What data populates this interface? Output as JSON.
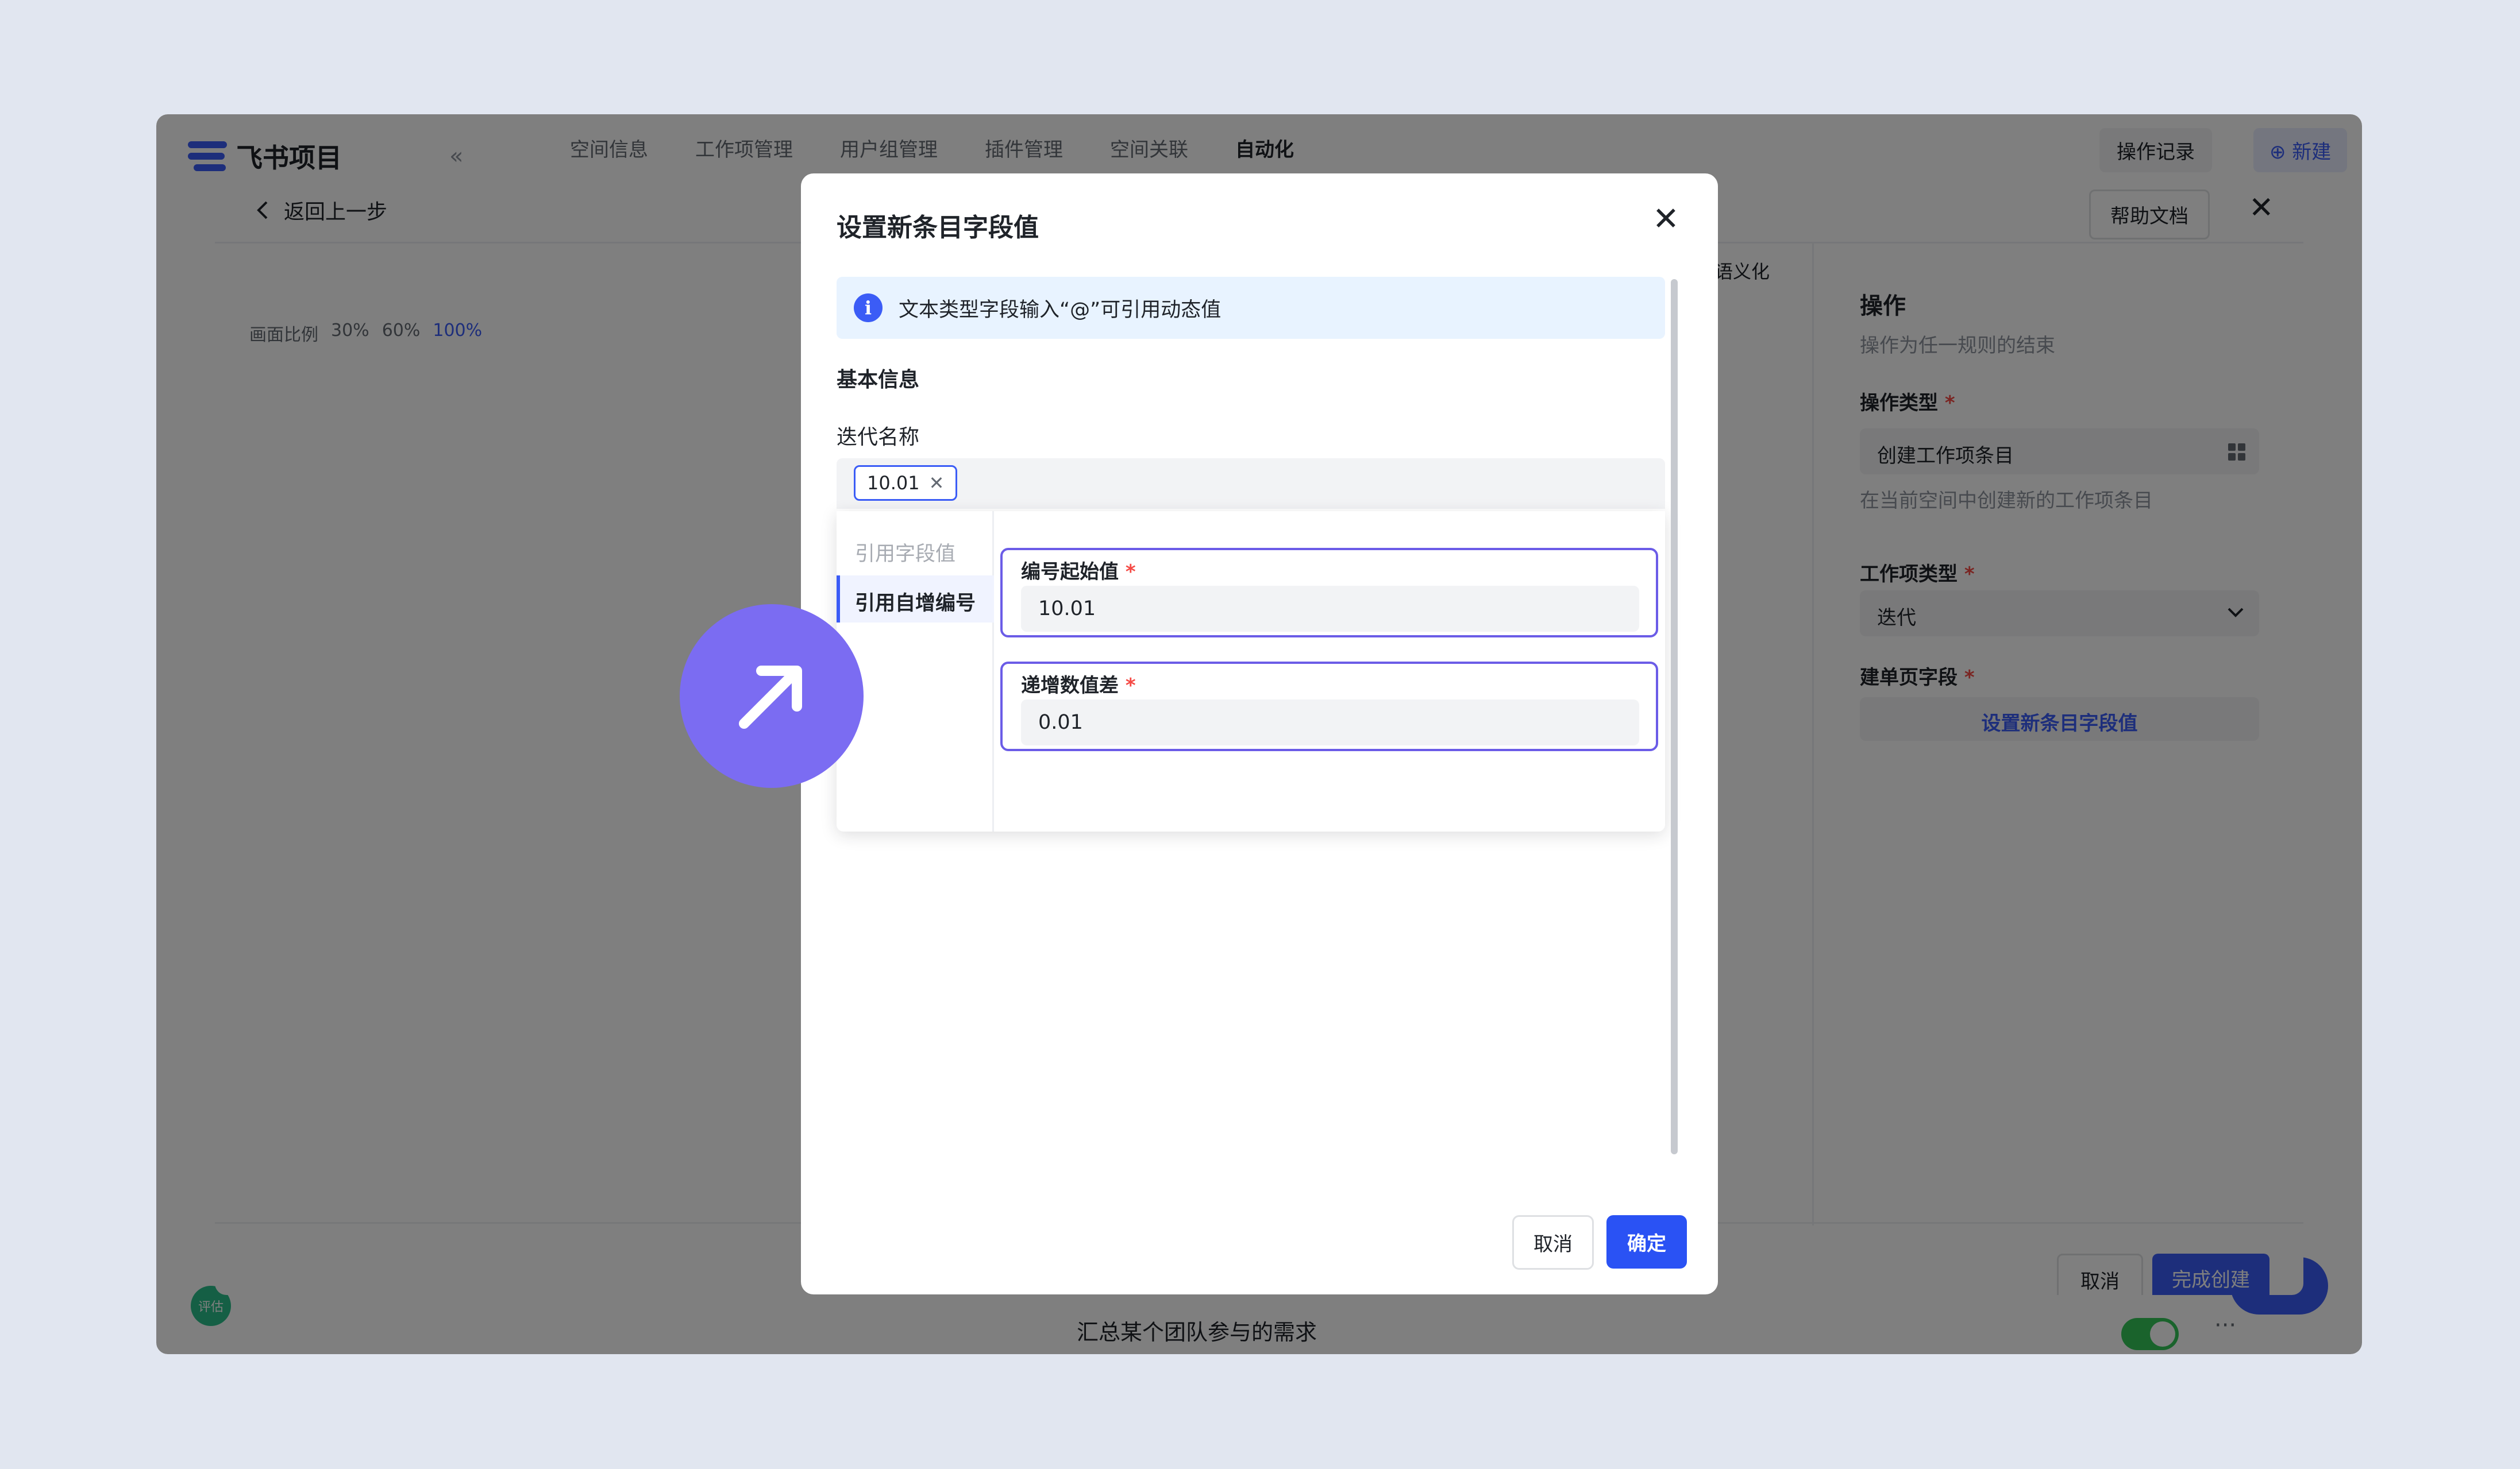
{
  "app": {
    "logo_text": "飞书项目",
    "collapse_icon": "«",
    "top_tabs": [
      "空间信息",
      "工作项管理",
      "用户组管理",
      "插件管理",
      "空间关联",
      "自动化"
    ],
    "active_tab": "自动化",
    "op_log_label": "操作记录",
    "new_label": "⊕ 新建",
    "bottom_text": "汇总某个团队参与的需求",
    "avatar_text": "评估",
    "more_icon": "···"
  },
  "editor": {
    "back_label": "返回上一步",
    "help_label": "帮助文档",
    "zoom_label": "画面比例",
    "zoom_options": [
      "30%",
      "60%",
      "100%"
    ],
    "active_zoom": "100%",
    "lang_label": "语义化",
    "right_panel": {
      "title": "操作",
      "subtitle": "操作为任一规则的结束",
      "action_type_label": "操作类型",
      "action_type_value": "创建工作项条目",
      "action_type_hint": "在当前空间中创建新的工作项条目",
      "item_type_label": "工作项类型",
      "item_type_value": "迭代",
      "form_field_label": "建单页字段",
      "form_field_button": "设置新条目字段值",
      "required_mark": "*"
    },
    "footer": {
      "cancel_label": "取消",
      "create_label": "完成创建"
    }
  },
  "modal": {
    "title": "设置新条目字段值",
    "close_icon": "✕",
    "info_text": "文本类型字段输入“@”可引用动态值",
    "info_icon": "i",
    "section_title": "基本信息",
    "field_label": "迭代名称",
    "chip_value": "10.01",
    "chip_remove_icon": "✕",
    "ref_menu": {
      "items": [
        "引用字段值",
        "引用自增编号"
      ],
      "active_item": "引用自增编号"
    },
    "fields": [
      {
        "label": "编号起始值",
        "required": "*",
        "value": "10.01"
      },
      {
        "label": "递增数值差",
        "required": "*",
        "value": "0.01"
      }
    ],
    "cancel_label": "取消",
    "ok_label": "确定"
  },
  "colors": {
    "accent": "#3b5cf6",
    "primary_button": "#2a52f4",
    "focus_border": "#6b5ce7",
    "cursor_badge": "#7b6cf2",
    "required": "#f54a45",
    "background": "#e1e6f0"
  },
  "icons": {
    "cursor": "arrow-up-right-icon",
    "info": "info-icon",
    "close": "close-icon",
    "back": "chevron-left-icon",
    "dropdown": "chevron-down-icon",
    "grid": "grid-icon"
  }
}
